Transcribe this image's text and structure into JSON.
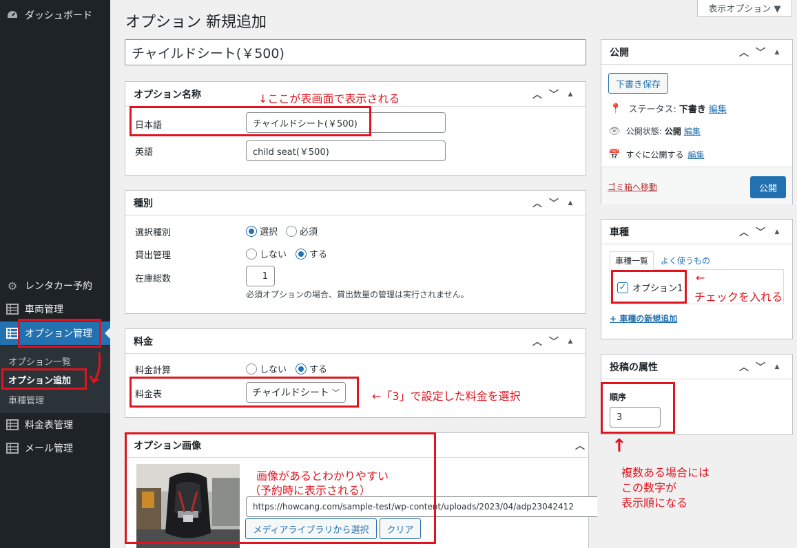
{
  "sidebar": {
    "items": [
      {
        "label": "ダッシュボード",
        "icon": "dashboard-icon"
      },
      {
        "label": "レンタカー予約",
        "icon": "gear-icon"
      },
      {
        "label": "車両管理",
        "icon": "list-icon"
      },
      {
        "label": "オプション管理",
        "icon": "list-icon"
      },
      {
        "label": "料金表管理",
        "icon": "list-icon"
      },
      {
        "label": "メール管理",
        "icon": "list-icon"
      }
    ],
    "submenu": [
      {
        "label": "オプション一覧"
      },
      {
        "label": "オプション追加"
      },
      {
        "label": "車種管理"
      }
    ]
  },
  "header": {
    "title": "オプション 新規追加",
    "screen_options": "表示オプション ▼"
  },
  "title_input": {
    "value": "チャイルドシート(￥500)"
  },
  "option_name": {
    "header": "オプション名称",
    "fields": [
      {
        "label": "日本語",
        "value": "チャイルドシート(￥500)"
      },
      {
        "label": "英語",
        "value": "child seat(￥500)"
      }
    ]
  },
  "type_box": {
    "header": "種別",
    "select_type": {
      "label": "選択種別",
      "opt1": "選択",
      "opt2": "必須"
    },
    "rental_mgmt": {
      "label": "貸出管理",
      "opt1": "しない",
      "opt2": "する"
    },
    "stock": {
      "label": "在庫総数",
      "value": "1",
      "note": "必須オプションの場合、貸出数量の管理は実行されません。"
    }
  },
  "price_box": {
    "header": "料金",
    "calc": {
      "label": "料金計算",
      "opt1": "しない",
      "opt2": "する"
    },
    "table": {
      "label": "料金表",
      "value": "チャイルドシート"
    }
  },
  "image_box": {
    "header": "オプション画像",
    "url": "https://howcang.com/sample-test/wp-content/uploads/2023/04/adp23042412",
    "media_button": "メディアライブラリから選択",
    "clear_button": "クリア"
  },
  "publish_box": {
    "header": "公開",
    "save_draft": "下書き保存",
    "status_label": "ステータス:",
    "status_value": "下書き",
    "visibility_label": "公開状態:",
    "visibility_value": "公開",
    "schedule_label": "すぐに公開する",
    "edit": "編集",
    "trash": "ゴミ箱へ移動",
    "publish": "公開"
  },
  "car_type_box": {
    "header": "車種",
    "tab_all": "車種一覧",
    "tab_popular": "よく使うもの",
    "item": "オプション1",
    "add_new": "+ 車種の新規追加"
  },
  "attributes_box": {
    "header": "投稿の属性",
    "order_label": "順序",
    "order_value": "3"
  },
  "annotations": {
    "name_note": "↓ここが表画面で表示される",
    "price_note": "←「3」で設定した料金を選択",
    "image_note_1": "画像があるとわかりやすい",
    "image_note_2": "（予約時に表示される）",
    "check_arrow": "←",
    "check_note": "チェックを入れる",
    "up_arrow": "↑",
    "order_note_1": "複数ある場合には",
    "order_note_2": "この数字が",
    "order_note_3": "表示順になる"
  },
  "colors": {
    "accent": "#2271b1",
    "sidebar": "#1d2327",
    "annotation": "#e0141e"
  }
}
